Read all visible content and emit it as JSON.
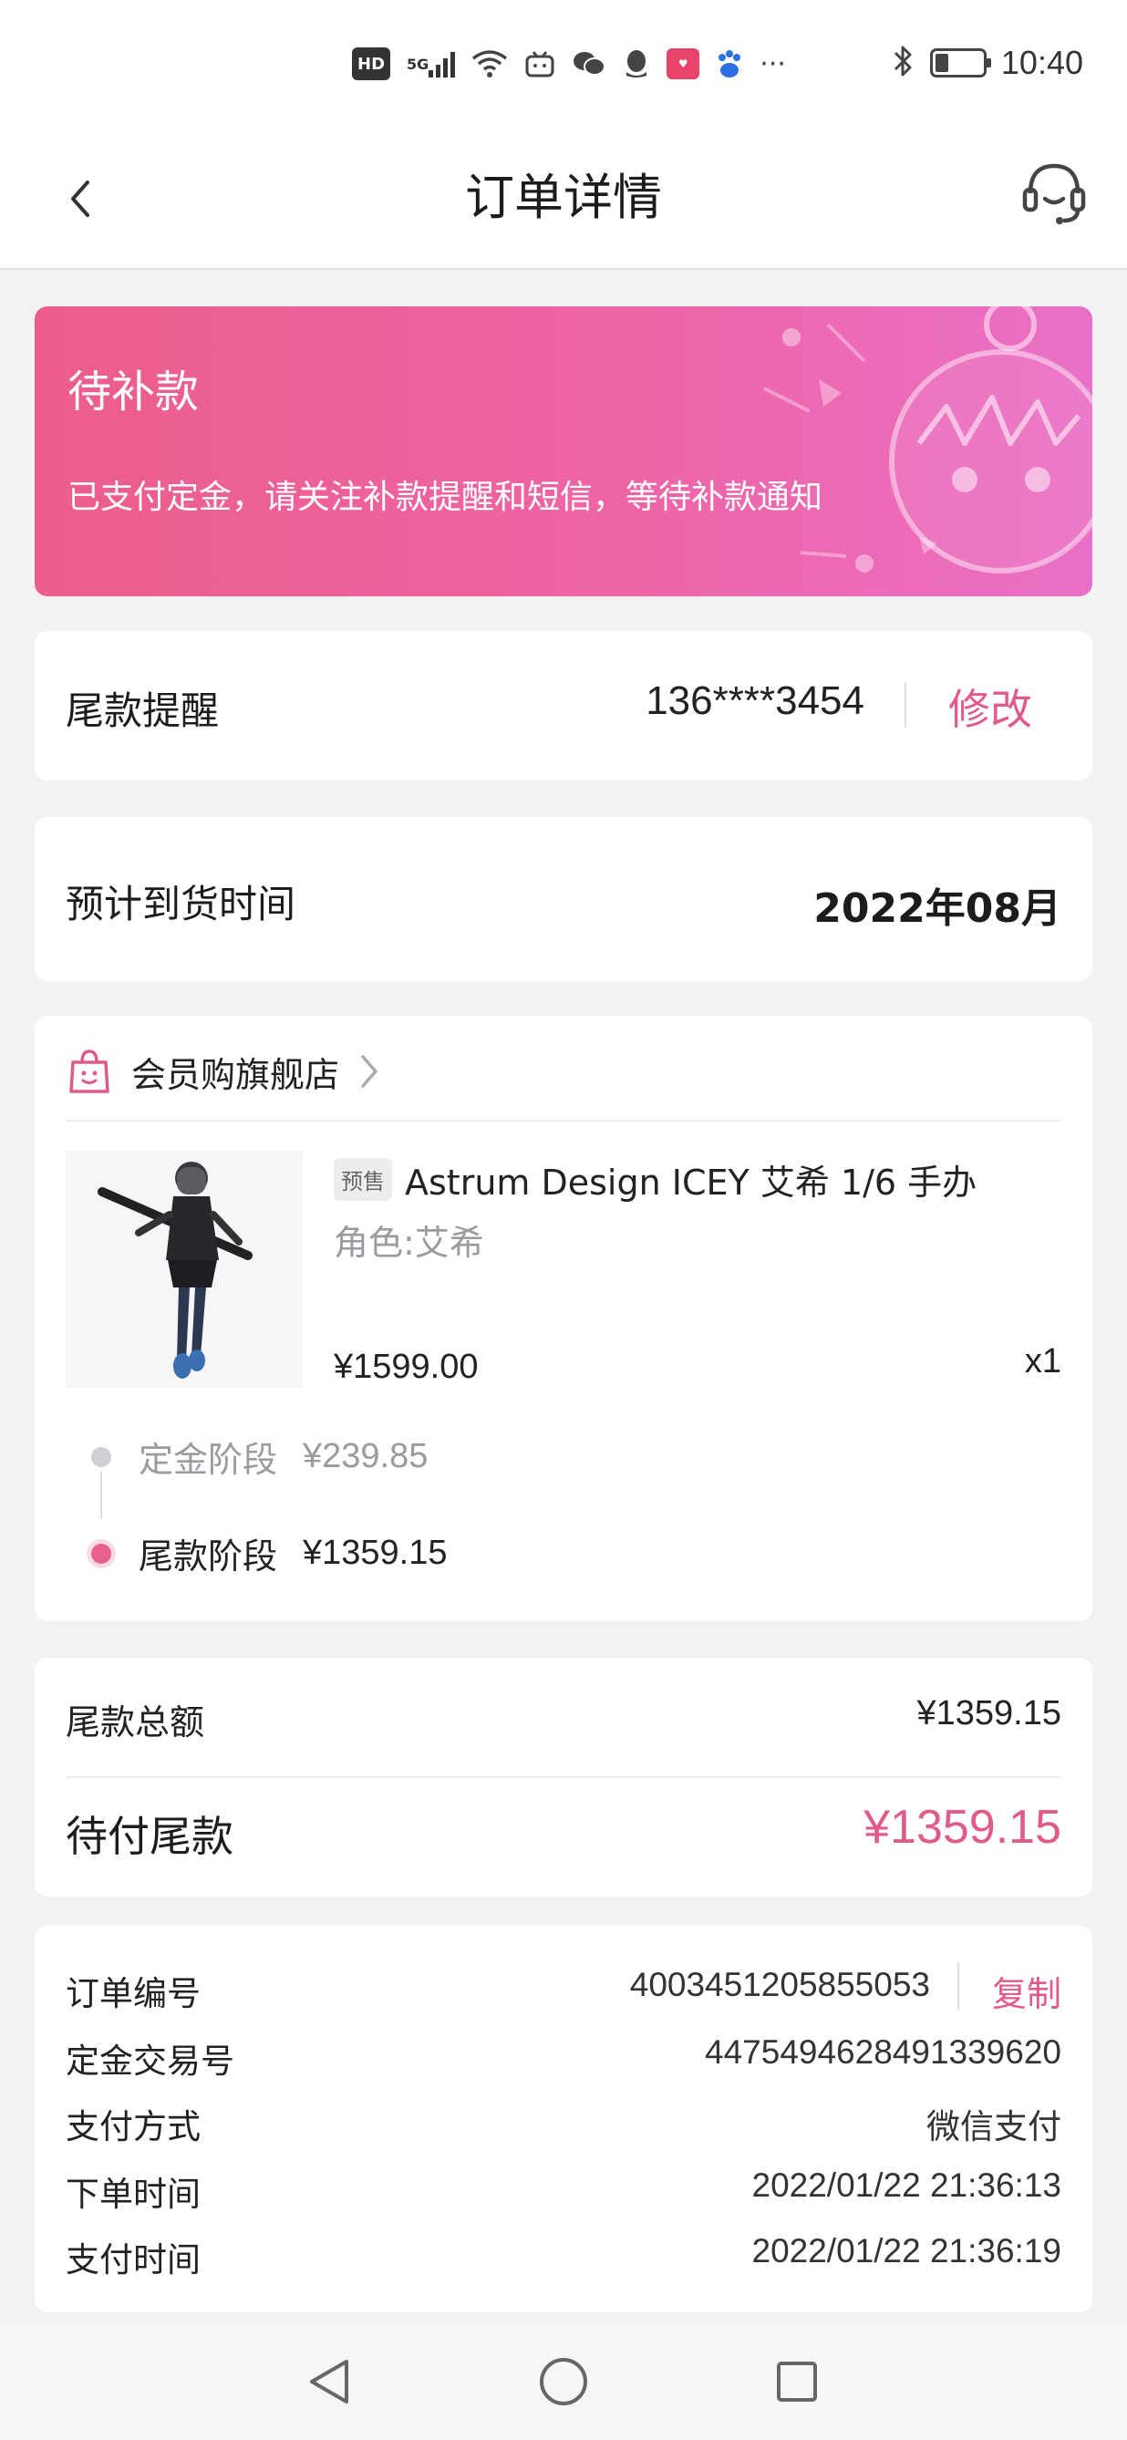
{
  "status_bar": {
    "time": "10:40",
    "hd": "HD",
    "network": "5G",
    "more": "···",
    "battery_level": 0.25,
    "icons": [
      "hd-icon",
      "signal-icon",
      "wifi-icon",
      "bilibili-icon",
      "wechat-icon",
      "qq-icon",
      "app-icon",
      "baidu-icon",
      "more-icon",
      "bluetooth-icon",
      "battery-icon"
    ]
  },
  "nav": {
    "title": "订单详情"
  },
  "banner": {
    "title": "待补款",
    "description": "已支付定金，请关注补款提醒和短信，等待补款通知"
  },
  "reminder": {
    "label": "尾款提醒",
    "phone": "136****3454",
    "edit_label": "修改"
  },
  "arrival": {
    "label": "预计到货时间",
    "value": "2022年08月"
  },
  "store": {
    "name": "会员购旗舰店"
  },
  "product": {
    "tag": "预售",
    "title": "Astrum Design ICEY 艾希 1/6 手办",
    "attribute": "角色:艾希",
    "price": "¥1599.00",
    "quantity": "x1"
  },
  "stages": [
    {
      "name": "定金阶段",
      "amount": "¥239.85",
      "state": "done"
    },
    {
      "name": "尾款阶段",
      "amount": "¥1359.15",
      "state": "current"
    }
  ],
  "summary": {
    "total_label": "尾款总额",
    "total_value": "¥1359.15",
    "pending_label": "待付尾款",
    "pending_value": "¥1359.15"
  },
  "order_info": {
    "order_no_label": "订单编号",
    "order_no": "4003451205855053",
    "copy_label": "复制",
    "deposit_txn_label": "定金交易号",
    "deposit_txn": "4475494628491339620",
    "pay_method_label": "支付方式",
    "pay_method": "微信支付",
    "order_time_label": "下单时间",
    "order_time": "2022/01/22 21:36:13",
    "pay_time_label": "支付时间",
    "pay_time": "2022/01/22 21:36:19"
  },
  "colors": {
    "accent": "#e05a8c",
    "banner_start": "#ec5d8b",
    "banner_end": "#ea6fc6",
    "background": "#f2f2f4"
  }
}
